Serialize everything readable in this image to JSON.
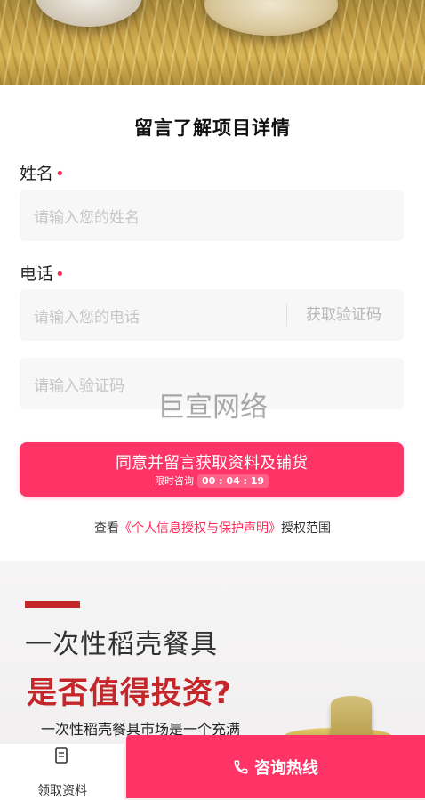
{
  "form": {
    "title": "留言了解项目详情",
    "name_label": "姓名",
    "name_placeholder": "请输入您的姓名",
    "phone_label": "电话",
    "phone_placeholder": "请输入您的电话",
    "get_code_label": "获取验证码",
    "code_placeholder": "请输入验证码",
    "required_mark": "•",
    "submit_label": "同意并留言获取资料及铺货",
    "submit_sub_label": "限时咨询",
    "countdown": "00 : 04 : 19",
    "agree_prefix": "查看",
    "agree_link": "《个人信息授权与保护声明》",
    "agree_suffix": "授权范围"
  },
  "watermark": "巨宣网络",
  "article": {
    "heading1": "一次性稻壳餐具",
    "heading2": "是否值得投资?",
    "paragraph": "一次性稻壳餐具市场是一个充满"
  },
  "bottom_bar": {
    "left_label": "领取资料",
    "left_icon": "document-icon",
    "hotline_label": "咨询热线",
    "hotline_icon": "phone-icon"
  },
  "colors": {
    "accent": "#ff3466",
    "heading_red": "#c4262a",
    "input_bg": "#f7f7f8"
  }
}
